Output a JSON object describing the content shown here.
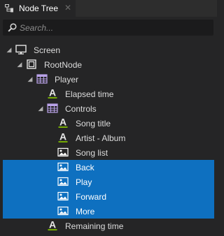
{
  "panel": {
    "tab_title": "Node Tree",
    "tab_icon": "node-tree-icon",
    "close_icon": "close-icon"
  },
  "search": {
    "placeholder": "Search...",
    "value": ""
  },
  "colors": {
    "background": "#252526",
    "selection": "#0e70c0",
    "text_icon_underline": "#7fba00",
    "image_icon": "#ffffff"
  },
  "tree": [
    {
      "label": "Screen",
      "depth": 0,
      "icon": "screen-icon",
      "expanded": true,
      "selected": false
    },
    {
      "label": "RootNode",
      "depth": 1,
      "icon": "empty-node-icon",
      "expanded": true,
      "selected": false
    },
    {
      "label": "Player",
      "depth": 2,
      "icon": "grid-layout-icon",
      "expanded": true,
      "selected": false
    },
    {
      "label": "Elapsed time",
      "depth": 3,
      "icon": "text-block-icon",
      "expanded": null,
      "selected": false
    },
    {
      "label": "Controls",
      "depth": 3,
      "icon": "grid-layout-icon",
      "expanded": true,
      "selected": false
    },
    {
      "label": "Song title",
      "depth": 4,
      "icon": "text-block-icon",
      "expanded": null,
      "selected": false
    },
    {
      "label": "Artist - Album",
      "depth": 4,
      "icon": "text-block-icon",
      "expanded": null,
      "selected": false
    },
    {
      "label": "Song list",
      "depth": 4,
      "icon": "image-icon",
      "expanded": null,
      "selected": false
    },
    {
      "label": "Back",
      "depth": 4,
      "icon": "image-icon",
      "expanded": null,
      "selected": true
    },
    {
      "label": "Play",
      "depth": 4,
      "icon": "image-icon",
      "expanded": null,
      "selected": true
    },
    {
      "label": "Forward",
      "depth": 4,
      "icon": "image-icon",
      "expanded": null,
      "selected": true
    },
    {
      "label": "More",
      "depth": 4,
      "icon": "image-icon",
      "expanded": null,
      "selected": true
    },
    {
      "label": "Remaining time",
      "depth": 3,
      "icon": "text-block-icon",
      "expanded": null,
      "selected": false
    }
  ]
}
